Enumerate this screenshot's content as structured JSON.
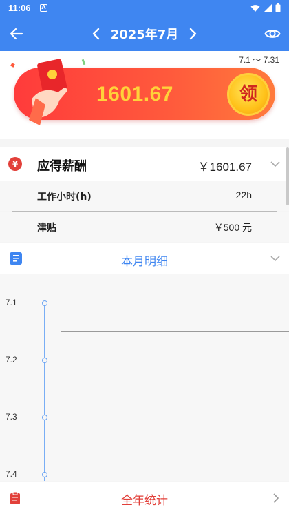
{
  "status": {
    "time": "11:06"
  },
  "appbar": {
    "month": "2025年7月"
  },
  "banner": {
    "range": "7.1 ～ 7.31",
    "amount": "1601.67",
    "claim_label": "领"
  },
  "salary": {
    "label": "应得薪酬",
    "value": "￥1601.67",
    "hours_label": "工作小时(h)",
    "hours_value": "22h",
    "allowance_label": "津贴",
    "allowance_value": "￥500 元"
  },
  "detail": {
    "label": "本月明细"
  },
  "timeline": {
    "dates": [
      "7.1",
      "7.2",
      "7.3",
      "7.4"
    ]
  },
  "year_stats": {
    "label": "全年统计"
  },
  "colors": {
    "primary": "#3f86f1",
    "red": "#e2403a",
    "gold": "#ffd23a"
  }
}
